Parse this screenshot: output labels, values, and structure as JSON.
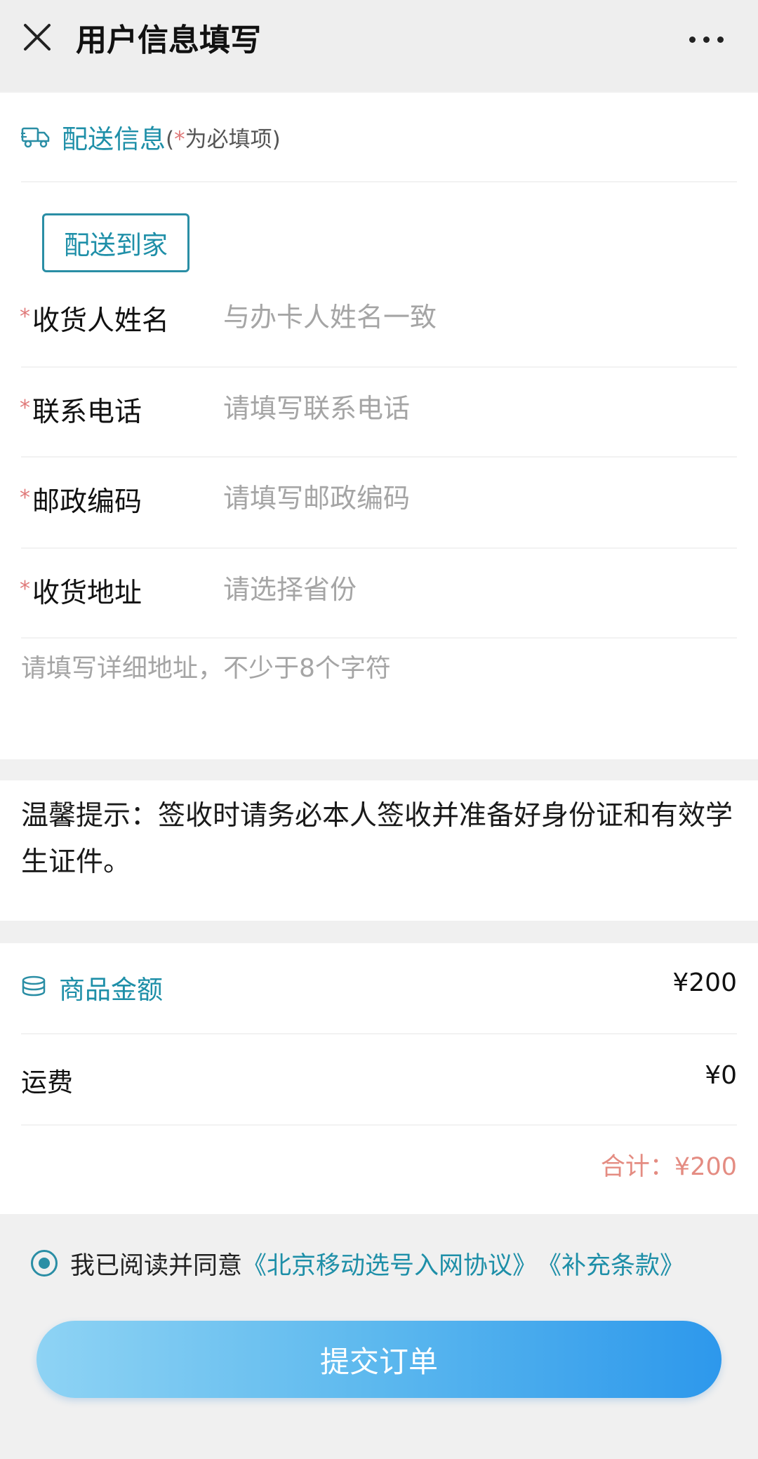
{
  "header": {
    "title": "用户信息填写",
    "close_icon": "close-icon",
    "more_icon": "more-icon"
  },
  "delivery": {
    "section_icon": "truck-icon",
    "section_label": "配送信息",
    "required_note_prefix": "(",
    "required_star": "*",
    "required_note_suffix": "为必填项)",
    "method_button": "配送到家",
    "fields": [
      {
        "star": "*",
        "label": "收货人姓名",
        "placeholder": "与办卡人姓名一致",
        "value": ""
      },
      {
        "star": "*",
        "label": "联系电话",
        "placeholder": "请填写联系电话",
        "value": ""
      },
      {
        "star": "*",
        "label": " 邮政编码",
        "placeholder": "请填写邮政编码",
        "value": ""
      },
      {
        "star": "*",
        "label": "收货地址",
        "placeholder": "请选择省份",
        "value": ""
      }
    ],
    "detail_placeholder": "请填写详细地址，不少于8个字符"
  },
  "tip": {
    "text": "温馨提示：签收时请务必本人签收并准备好身份证和有效学生证件。"
  },
  "amount": {
    "section_icon": "coins-icon",
    "goods_label": "商品金额",
    "goods_value": "¥200",
    "shipping_label": "运费",
    "shipping_value": "¥0",
    "total": "合计：¥200"
  },
  "agreement": {
    "checked": true,
    "text": "我已阅读并同意",
    "link1": "《北京移动选号入网协议》",
    "link2": "《补充条款》"
  },
  "submit": {
    "label": "提交订单"
  },
  "colors": {
    "accent": "#1e8fa8",
    "required_star": "#e07a7a",
    "total": "#e48c82",
    "button_start": "#8ed3f4",
    "button_end": "#2d98ec"
  }
}
